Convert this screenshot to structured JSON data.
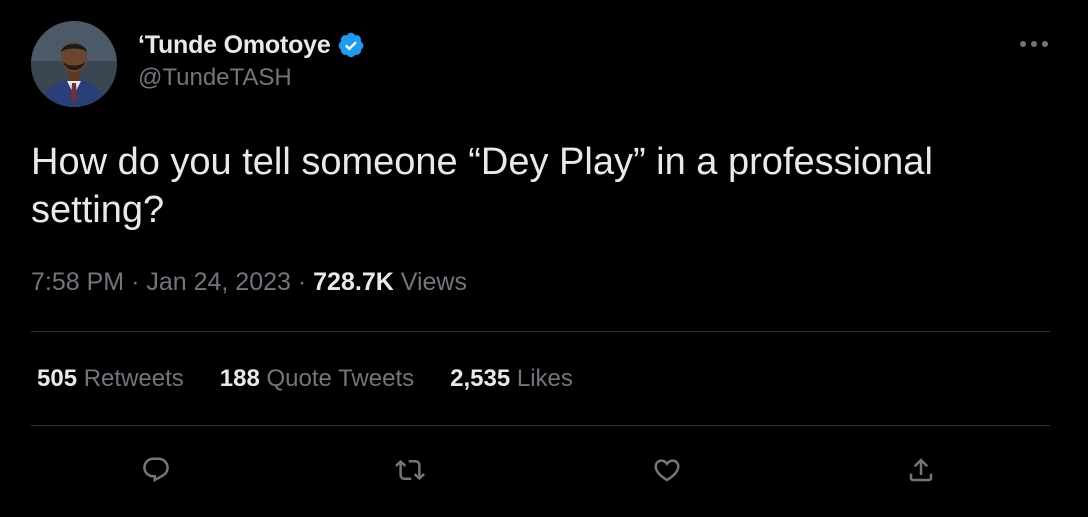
{
  "author": {
    "display_name": "‘Tunde Omotoye",
    "handle": "@TundeTASH",
    "verified": true,
    "avatar": "avatar-photo-man-in-suit"
  },
  "tweet": {
    "text": "How do you tell someone “Dey Play” in a professional setting?",
    "time": "7:58 PM",
    "separator": "·",
    "date": "Jan 24, 2023",
    "views_count": "728.7K",
    "views_label": "Views"
  },
  "stats": {
    "retweets_count": "505",
    "retweets_label": "Retweets",
    "quotes_count": "188",
    "quotes_label": "Quote Tweets",
    "likes_count": "2,535",
    "likes_label": "Likes"
  },
  "icons": {
    "more": "more-horizontal-icon",
    "verified": "verified-badge-icon",
    "reply": "reply-icon",
    "retweet": "retweet-icon",
    "like": "heart-icon",
    "share": "share-icon"
  },
  "colors": {
    "background": "#000000",
    "text_primary": "#e7e9ea",
    "text_secondary": "#71767b",
    "verified_blue": "#1d9bf0",
    "divider": "#2f3336"
  }
}
